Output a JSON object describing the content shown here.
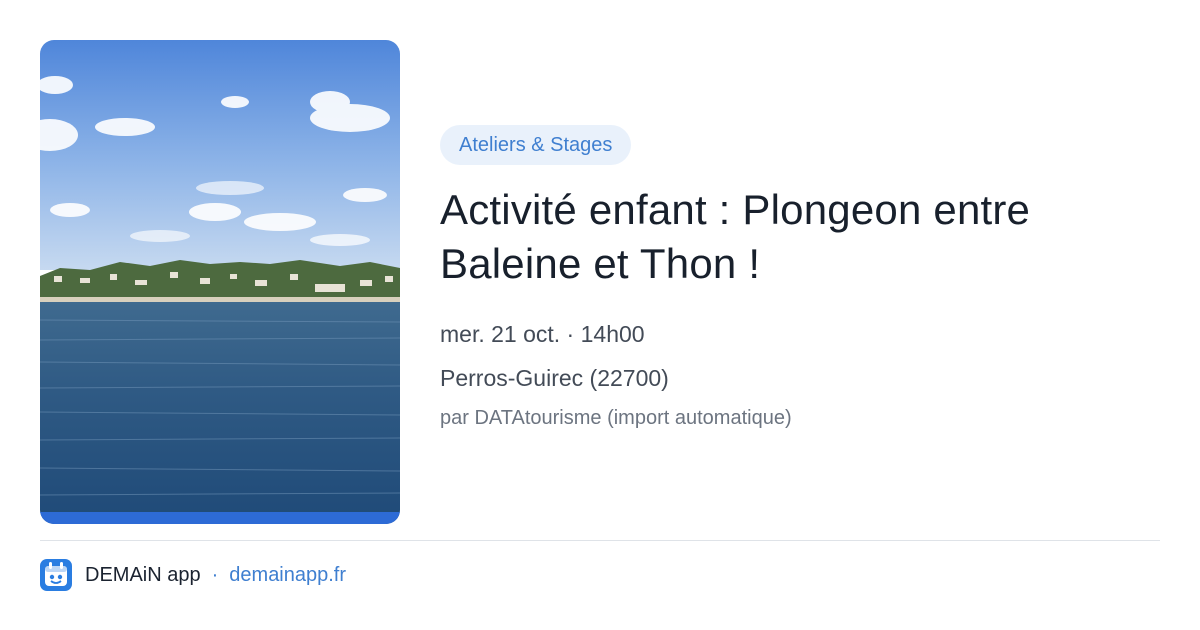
{
  "card": {
    "image_alt": "Vue sur la mer et la côte de Perros-Guirec",
    "category": "Ateliers & Stages",
    "title": "Activité enfant : Plongeon entre Baleine et Thon !",
    "date": "mer. 21 oct. · 14h00",
    "location": "Perros-Guirec (22700)",
    "source": "par DATAtourisme (import automatique)"
  },
  "footer": {
    "app_name": "DEMAiN app",
    "separator": "·",
    "url": "demainapp.fr",
    "logo_icon": "demain-app-logo-icon"
  },
  "colors": {
    "accent": "#3f7fd0",
    "badge_bg": "#e9f1fb",
    "title": "#18202c",
    "meta": "#434b57",
    "source": "#6c7480",
    "divider": "#dfe3e8"
  }
}
